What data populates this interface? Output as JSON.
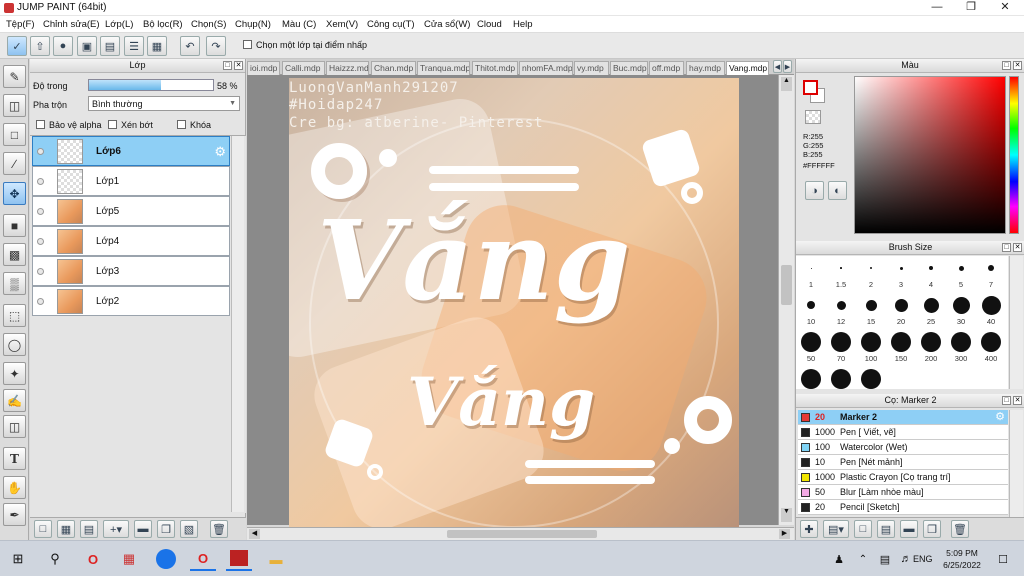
{
  "window": {
    "title": "JUMP PAINT (64bit)"
  },
  "menu": [
    "Tệp(F)",
    "Chỉnh sửa(E)",
    "Lớp(L)",
    "Bộ lọc(R)",
    "Chọn(S)",
    "Chụp(N)",
    "Màu (C)",
    "Xem(V)",
    "Công cụ(T)",
    "Cửa sổ(W)",
    "Cloud",
    "Help"
  ],
  "toolbar": {
    "select_layer_label": "Chọn một lớp tại điểm nhấp"
  },
  "layer_panel": {
    "title": "Lớp",
    "opacity_label": "Độ trong",
    "opacity_value": "58 %",
    "opacity_fraction": 0.58,
    "blend_label": "Pha trộn",
    "blend_value": "Bình thường",
    "protect_alpha": "Bảo vệ alpha",
    "clipping": "Xén bớt",
    "lock": "Khóa",
    "layers": [
      {
        "name": "Lớp6",
        "selected": true,
        "thumb": "transparent"
      },
      {
        "name": "Lớp1",
        "selected": false,
        "thumb": "transparent"
      },
      {
        "name": "Lớp5",
        "selected": false,
        "thumb": "photo"
      },
      {
        "name": "Lớp4",
        "selected": false,
        "thumb": "photo"
      },
      {
        "name": "Lớp3",
        "selected": false,
        "thumb": "photo"
      },
      {
        "name": "Lớp2",
        "selected": false,
        "thumb": "photo"
      }
    ]
  },
  "tabs": [
    "ioi.mdp",
    "Calli.mdp",
    "Haizzz.mdp",
    "Chan.mdp",
    "Tranqua.mdp",
    "Thitot.mdp",
    "nhomFA.mdp",
    "vy.mdp",
    "Buc.mdp",
    "off.mdp",
    "hay.mdp",
    "Vang.mdp"
  ],
  "canvas": {
    "line1": "LuongVanManh291207",
    "line2": "#Hoidap247",
    "line3": "Cre bg: atberine- Pinterest",
    "big_title": "Vắng",
    "sub_title": "Vắng"
  },
  "color_panel": {
    "title": "Màu",
    "r": "R:255",
    "g": "G:255",
    "b": "B:255",
    "hex": "#FFFFFF"
  },
  "brush_panel": {
    "title": "Brush Size",
    "sizes": [
      "1",
      "1.5",
      "2",
      "3",
      "4",
      "5",
      "7",
      "10",
      "12",
      "15",
      "20",
      "25",
      "30",
      "40",
      "50",
      "70",
      "100",
      "150",
      "200",
      "300",
      "400"
    ]
  },
  "tool_panel": {
    "title": "Cọ: Marker 2",
    "items": [
      {
        "size": "20",
        "name": "Marker 2",
        "color": "#e53935",
        "selected": true
      },
      {
        "size": "1000",
        "name": "Pen [ Viết, vẽ]",
        "color": "#222222",
        "selected": false
      },
      {
        "size": "100",
        "name": "Watercolor (Wet)",
        "color": "#7fd3f5",
        "selected": false
      },
      {
        "size": "10",
        "name": "Pen [Nét mảnh]",
        "color": "#222222",
        "selected": false
      },
      {
        "size": "1000",
        "name": "Plastic Crayon [Cọ trang trí]",
        "color": "#f2e600",
        "selected": false
      },
      {
        "size": "50",
        "name": "Blur [Làm nhòe màu]",
        "color": "#f3a9e4",
        "selected": false
      },
      {
        "size": "20",
        "name": "Pencil [Sketch]",
        "color": "#222222",
        "selected": false
      }
    ]
  },
  "taskbar": {
    "lang": "ENG",
    "time": "5:09 PM",
    "date": "6/25/2022"
  }
}
